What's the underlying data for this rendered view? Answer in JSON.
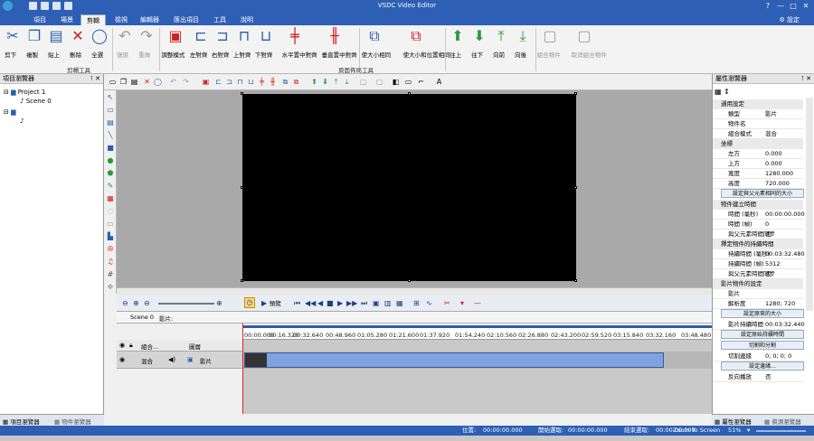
{
  "window": {
    "title": "VSDC Video Editor",
    "settings": "設定"
  },
  "menu": {
    "tabs": [
      "項目",
      "場景",
      "剪輯",
      "檢視",
      "編輯器",
      "匯出項目",
      "工具",
      "說明"
    ],
    "active_index": 2
  },
  "ribbon": {
    "clip_buttons": [
      "剪下",
      "複製",
      "貼上",
      "刪除",
      "全選"
    ],
    "undo_buttons": [
      "復原",
      "重做"
    ],
    "clip_group": "剪輯工具",
    "layout_buttons": [
      "調整模式",
      "左對齊",
      "右對齊",
      "上對齊",
      "下對齊",
      "水平置中對齊",
      "垂直置中對齊",
      "使大小相同",
      "使大小和位置相同",
      "往上",
      "往下",
      "向前",
      "向後"
    ],
    "layout_group": "頁面佈局工具",
    "combine_buttons": [
      "組合物件",
      "取消組合物件"
    ]
  },
  "left_panel": {
    "title": "項目瀏覽器",
    "tree": [
      "Project 1",
      "Scene 0"
    ],
    "tabs": [
      "項目瀏覽器",
      "物件瀏覽器"
    ]
  },
  "timeline": {
    "preview_label": "預覽",
    "scene_tab": "Scene 0",
    "clip_tab": "影片:",
    "layer_header": [
      "組合...",
      "圖層"
    ],
    "layer_row": [
      "混合",
      "影片"
    ],
    "ruler": [
      "00:00.000",
      "00:16.320",
      "00:32.640",
      "00:48.960",
      "01:05.280",
      "01:21.600",
      "01:37.920",
      "01:54.240",
      "02:10.560",
      "02:26.880",
      "02:43.200",
      "02:59.520",
      "03:15.840",
      "03:32.160",
      "03:48.480"
    ]
  },
  "properties": {
    "title": "屬性瀏覽器",
    "common": "通用設定",
    "rows1": [
      [
        "類型",
        "影片"
      ],
      [
        "物件名",
        ""
      ],
      [
        "組合模式",
        "混合"
      ]
    ],
    "coords": "坐標",
    "rows2": [
      [
        "左方",
        "0.000"
      ],
      [
        "上方",
        "0.000"
      ],
      [
        "寬度",
        "1280.000"
      ],
      [
        "高度",
        "720.000"
      ]
    ],
    "btn1": "設定與父元素相同的大小",
    "time_sec": "物件建立時間",
    "rows3": [
      [
        "時間 (毫秒)",
        "00:00:00.000"
      ],
      [
        "時間 (幀)",
        "0"
      ],
      [
        "與父元素時間同步",
        "否"
      ]
    ],
    "dur_sec": "擇定物件的持續時間",
    "rows4": [
      [
        "持續時間 (毫秒)",
        "00:03:32.480"
      ],
      [
        "持續時間 (幀)",
        "5312"
      ],
      [
        "與父元素時間同步",
        "否"
      ]
    ],
    "video_sec": "影片物件的設定",
    "rows5": [
      [
        "影片",
        ""
      ],
      [
        "解析度",
        "1280; 720"
      ]
    ],
    "btn2": "設定原來的大小",
    "rows6": [
      [
        "影片持續時間",
        "00:03:32.440"
      ]
    ],
    "btn3": "設定原始持續時間",
    "btn4": "切割和分割",
    "rows7": [
      [
        "切割邊緣",
        "0; 0; 0; 0"
      ]
    ],
    "btn5": "設定邊緣...",
    "rows8": [
      [
        "反向播放",
        "否"
      ]
    ],
    "tabs": [
      "屬性瀏覽器",
      "資源瀏覽器"
    ]
  },
  "status": {
    "position_label": "位置:",
    "position": "00:00:00.000",
    "start_label": "開始選取:",
    "start": "00:00:00.000",
    "end_label": "結束選取:",
    "end": "00:00:00.000",
    "zoom_label": "Zoom To Screen",
    "zoom": "51%"
  }
}
